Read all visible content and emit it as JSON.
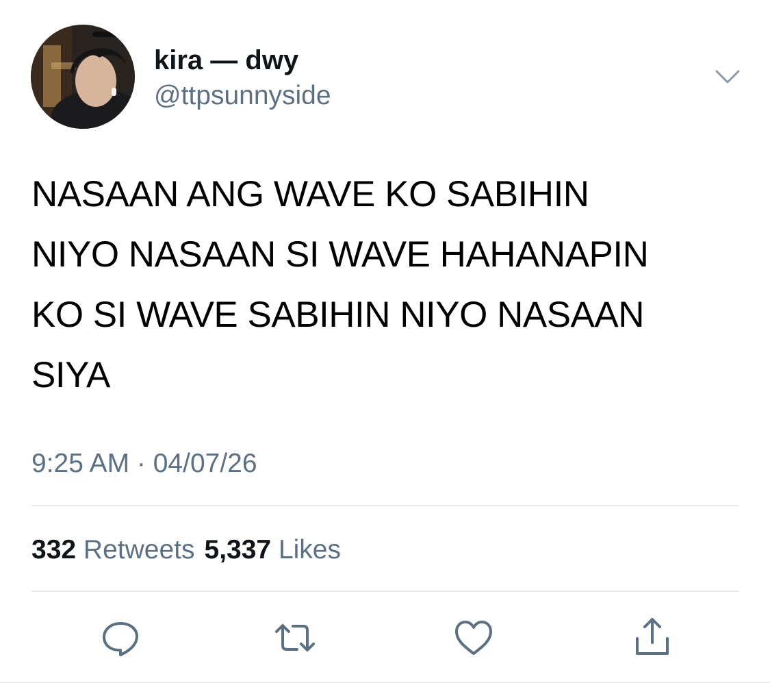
{
  "tweet": {
    "author": {
      "display_name": "kira — dwy",
      "handle": "@ttpsunnyside"
    },
    "text": "NASAAN ANG WAVE KO SABIHIN\nNIYO NASAAN SI WAVE HAHANAPIN\nKO SI WAVE SABIHIN NIYO NASAAN\nSIYA",
    "timestamp": "9:25 AM · 04/07/26",
    "stats": {
      "retweets_count": "332",
      "retweets_label": "Retweets",
      "likes_count": "5,337",
      "likes_label": "Likes"
    },
    "actions": [
      {
        "icon": "reply-icon"
      },
      {
        "icon": "retweet-icon"
      },
      {
        "icon": "like-icon"
      },
      {
        "icon": "share-icon"
      }
    ]
  },
  "colors": {
    "text_primary": "#0f1419",
    "text_secondary": "#5b7083",
    "divider": "#e6ecf0",
    "background": "#ffffff"
  }
}
